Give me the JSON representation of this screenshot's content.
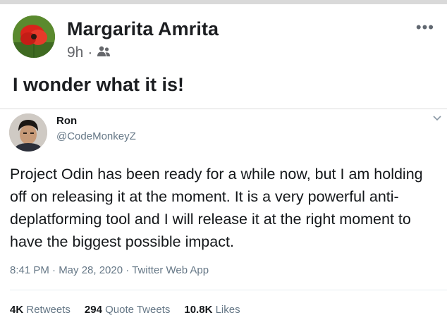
{
  "post": {
    "author": "Margarita Amrita",
    "time": "9h",
    "separator": "·",
    "audience_icon": "friends-icon",
    "more_icon": "more-options-icon",
    "text": "I wonder what it is!"
  },
  "tweet": {
    "name": "Ron",
    "handle": "@CodeMonkeyZ",
    "body": "Project Odin has been ready for a while now, but I am holding off on releasing it at the moment. It is a very powerful anti-deplatforming tool and I will release it at the right moment to have the biggest possible impact.",
    "meta": "8:41 PM · May 28, 2020 · Twitter Web App",
    "stats": {
      "retweets_count": "4K",
      "retweets_label": "Retweets",
      "quotes_count": "294",
      "quotes_label": "Quote Tweets",
      "likes_count": "10.8K",
      "likes_label": "Likes"
    }
  }
}
